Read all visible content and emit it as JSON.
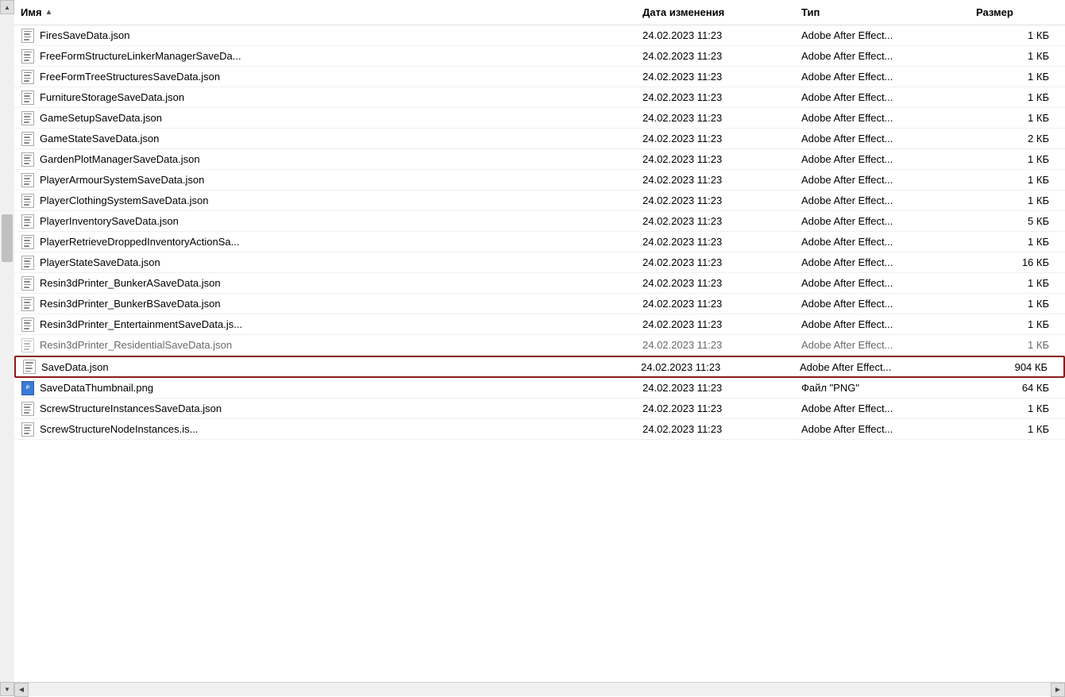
{
  "header": {
    "columns": {
      "name": "Имя",
      "date": "Дата изменения",
      "type": "Тип",
      "size": "Размер"
    }
  },
  "files": [
    {
      "id": 1,
      "name": "FiresSaveData.json",
      "icon": "json",
      "date": "24.02.2023 11:23",
      "type": "Adobe After Effect...",
      "size": "1 КБ",
      "highlighted": false
    },
    {
      "id": 2,
      "name": "FreeFormStructureLinkerManagerSaveDa...",
      "icon": "json",
      "date": "24.02.2023 11:23",
      "type": "Adobe After Effect...",
      "size": "1 КБ",
      "highlighted": false
    },
    {
      "id": 3,
      "name": "FreeFormTreeStructuresSaveData.json",
      "icon": "json",
      "date": "24.02.2023 11:23",
      "type": "Adobe After Effect...",
      "size": "1 КБ",
      "highlighted": false
    },
    {
      "id": 4,
      "name": "FurnitureStorageSaveData.json",
      "icon": "json",
      "date": "24.02.2023 11:23",
      "type": "Adobe After Effect...",
      "size": "1 КБ",
      "highlighted": false
    },
    {
      "id": 5,
      "name": "GameSetupSaveData.json",
      "icon": "json",
      "date": "24.02.2023 11:23",
      "type": "Adobe After Effect...",
      "size": "1 КБ",
      "highlighted": false
    },
    {
      "id": 6,
      "name": "GameStateSaveData.json",
      "icon": "json",
      "date": "24.02.2023 11:23",
      "type": "Adobe After Effect...",
      "size": "2 КБ",
      "highlighted": false
    },
    {
      "id": 7,
      "name": "GardenPlotManagerSaveData.json",
      "icon": "json",
      "date": "24.02.2023 11:23",
      "type": "Adobe After Effect...",
      "size": "1 КБ",
      "highlighted": false
    },
    {
      "id": 8,
      "name": "PlayerArmourSystemSaveData.json",
      "icon": "json",
      "date": "24.02.2023 11:23",
      "type": "Adobe After Effect...",
      "size": "1 КБ",
      "highlighted": false
    },
    {
      "id": 9,
      "name": "PlayerClothingSystemSaveData.json",
      "icon": "json",
      "date": "24.02.2023 11:23",
      "type": "Adobe After Effect...",
      "size": "1 КБ",
      "highlighted": false
    },
    {
      "id": 10,
      "name": "PlayerInventorySaveData.json",
      "icon": "json",
      "date": "24.02.2023 11:23",
      "type": "Adobe After Effect...",
      "size": "5 КБ",
      "highlighted": false
    },
    {
      "id": 11,
      "name": "PlayerRetrieveDroppedInventoryActionSa...",
      "icon": "json",
      "date": "24.02.2023 11:23",
      "type": "Adobe After Effect...",
      "size": "1 КБ",
      "highlighted": false
    },
    {
      "id": 12,
      "name": "PlayerStateSaveData.json",
      "icon": "json",
      "date": "24.02.2023 11:23",
      "type": "Adobe After Effect...",
      "size": "16 КБ",
      "highlighted": false
    },
    {
      "id": 13,
      "name": "Resin3dPrinter_BunkerASaveData.json",
      "icon": "json",
      "date": "24.02.2023 11:23",
      "type": "Adobe After Effect...",
      "size": "1 КБ",
      "highlighted": false
    },
    {
      "id": 14,
      "name": "Resin3dPrinter_BunkerBSaveData.json",
      "icon": "json",
      "date": "24.02.2023 11:23",
      "type": "Adobe After Effect...",
      "size": "1 КБ",
      "highlighted": false
    },
    {
      "id": 15,
      "name": "Resin3dPrinter_EntertainmentSaveData.js...",
      "icon": "json",
      "date": "24.02.2023 11:23",
      "type": "Adobe After Effect...",
      "size": "1 КБ",
      "highlighted": false
    },
    {
      "id": 16,
      "name": "Resin3dPrinter_ResidentialSaveData.json",
      "icon": "json",
      "date": "24.02.2023 11:23",
      "type": "Adobe After Effect...",
      "size": "1 КБ",
      "highlighted": false,
      "faded": true
    },
    {
      "id": 17,
      "name": "SaveData.json",
      "icon": "json",
      "date": "24.02.2023 11:23",
      "type": "Adobe After Effect...",
      "size": "904 КБ",
      "highlighted": true
    },
    {
      "id": 18,
      "name": "SaveDataThumbnail.png",
      "icon": "png",
      "date": "24.02.2023 11:23",
      "type": "Файл \"PNG\"",
      "size": "64 КБ",
      "highlighted": false
    },
    {
      "id": 19,
      "name": "ScrewStructureInstancesSaveData.json",
      "icon": "json",
      "date": "24.02.2023 11:23",
      "type": "Adobe After Effect...",
      "size": "1 КБ",
      "highlighted": false
    },
    {
      "id": 20,
      "name": "ScrewStructureNodeInstances.is...",
      "icon": "json",
      "date": "24.02.2023 11:23",
      "type": "Adobe After Effect...",
      "size": "1 КБ",
      "highlighted": false
    }
  ]
}
